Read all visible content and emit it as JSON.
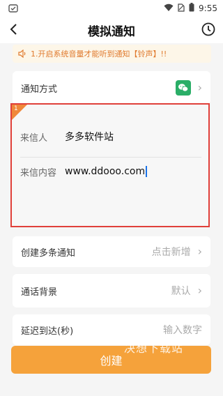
{
  "status_bar": {
    "time": "9:55"
  },
  "nav": {
    "title": "模拟通知"
  },
  "notice": {
    "text": "1.开启系统音量才能听到通知【铃声】!!"
  },
  "method": {
    "label": "通知方式",
    "icon": "wechat-icon"
  },
  "message": {
    "index": "1",
    "sender_label": "来信人",
    "sender_value": "多多软件站",
    "content_label": "来信内容",
    "content_value": "www.ddooo.com"
  },
  "multi": {
    "label": "创建多条通知",
    "action": "点击新增"
  },
  "background": {
    "label": "通话背景",
    "value": "默认"
  },
  "delay": {
    "label": "延迟到达(秒)",
    "placeholder": "输入数字"
  },
  "watermark": "决想下载站",
  "create_button": {
    "label": "创建"
  },
  "colors": {
    "accent": "#f5a23b",
    "notice_text": "#e07a2e",
    "highlight": "#e0403a",
    "wechat": "#2aae67"
  }
}
